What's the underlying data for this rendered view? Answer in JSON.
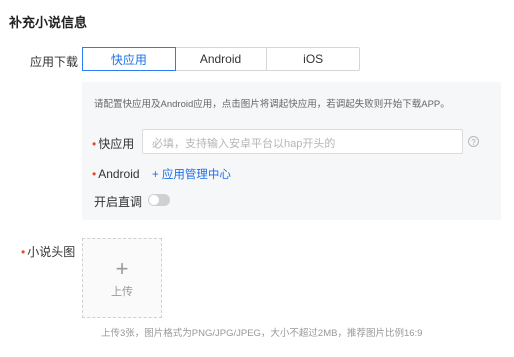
{
  "title": "补充小说信息",
  "app_download": {
    "label": "应用下载",
    "tabs": [
      "快应用",
      "Android",
      "iOS"
    ],
    "hint": "请配置快应用及Android应用，点击图片将调起快应用，若调起失败则开始下载APP。",
    "quick_app": {
      "label": "快应用",
      "placeholder": "必填，支持输入安卓平台以hap开头的"
    },
    "android": {
      "label": "Android",
      "link": "+ 应用管理中心"
    },
    "direct": {
      "label": "开启直调",
      "enabled": false
    }
  },
  "avatar": {
    "label": "小说头图",
    "upload_plus": "+",
    "upload_text": "上传",
    "hint": "上传3张，图片格式为PNG/JPG/JPEG，大小不超过2MB，推荐图片比例16:9"
  },
  "colors": {
    "accent": "#1f6feb",
    "required": "#e34d2e",
    "panel_bg": "#f6f7f9"
  },
  "icons": {
    "help": "question-circle-icon"
  }
}
